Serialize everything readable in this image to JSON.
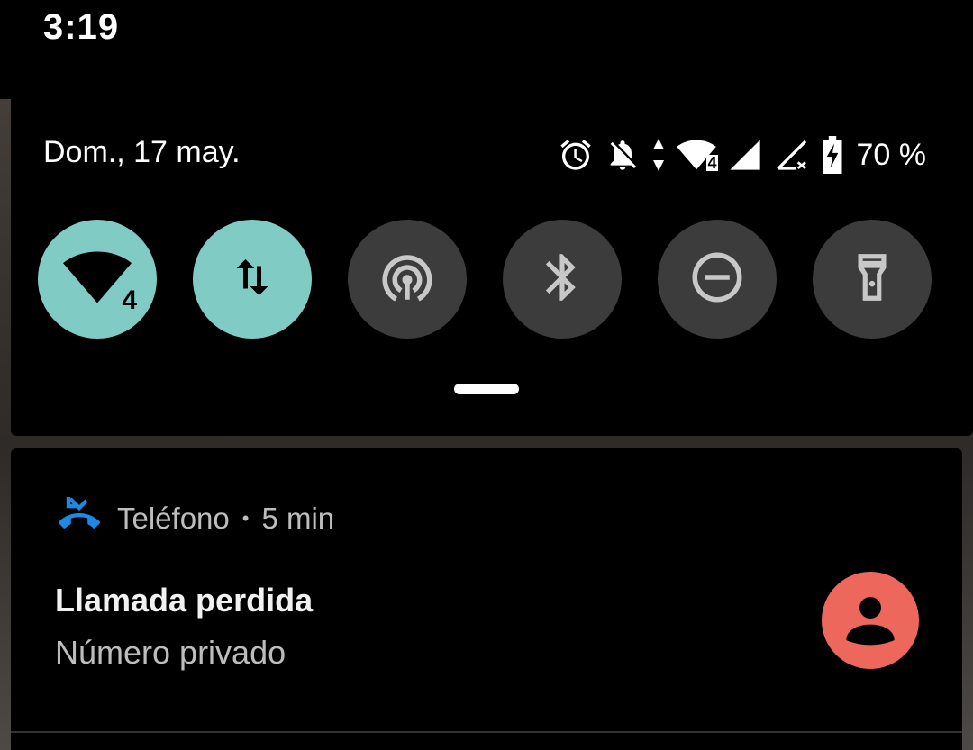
{
  "status_bar": {
    "time": "3:19"
  },
  "quick_settings": {
    "date": "Dom., 17 may.",
    "battery_percent": "70 %",
    "status_icons": [
      "alarm-icon",
      "notifications-off-icon",
      "data-activity-icon",
      "wifi-icon",
      "signal-icon",
      "no-signal-icon",
      "battery-charging-icon"
    ],
    "wifi_badge": "4",
    "tiles": [
      {
        "name": "wifi",
        "icon": "wifi-icon",
        "active": true
      },
      {
        "name": "mobile-data",
        "icon": "data-arrows-icon",
        "active": true
      },
      {
        "name": "hotspot",
        "icon": "hotspot-icon",
        "active": false
      },
      {
        "name": "bluetooth",
        "icon": "bluetooth-icon",
        "active": false
      },
      {
        "name": "do-not-disturb",
        "icon": "dnd-icon",
        "active": false
      },
      {
        "name": "flashlight",
        "icon": "flashlight-icon",
        "active": false
      }
    ],
    "colors": {
      "active_tile": "#80cbc4",
      "inactive_tile": "#3c3c3c"
    }
  },
  "notification": {
    "app_name": "Teléfono",
    "separator": "•",
    "time": "5 min",
    "title": "Llamada perdida",
    "text": "Número privado",
    "app_icon": "missed-call-icon",
    "colors": {
      "app_icon": "#1e88e5",
      "avatar": "#ee675c"
    }
  }
}
